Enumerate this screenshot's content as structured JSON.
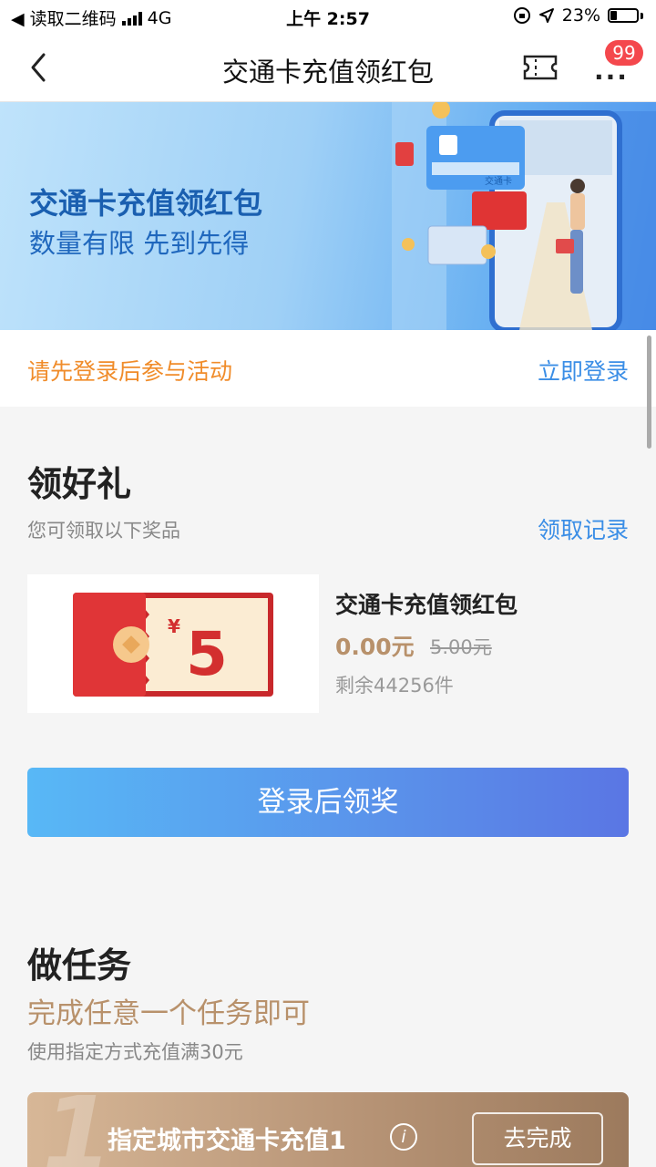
{
  "status_bar": {
    "back_app": "◀ 读取二维码",
    "network": "4G",
    "time": "上午 2:57",
    "battery": "23%"
  },
  "nav": {
    "title": "交通卡充值领红包",
    "more_label": "···",
    "badge": "99"
  },
  "banner": {
    "title": "交通卡充值领红包",
    "subtitle": "数量有限 先到先得",
    "card_label": "交通卡"
  },
  "login": {
    "hint": "请先登录后参与活动",
    "link": "立即登录"
  },
  "gifts": {
    "title": "领好礼",
    "desc": "您可领取以下奖品",
    "record_link": "领取记录",
    "item": {
      "yen": "¥",
      "amount": "5",
      "name": "交通卡充值领红包",
      "price": "0.00元",
      "original_price": "5.00元",
      "remaining": "剩余44256件"
    },
    "button": "登录后领奖"
  },
  "tasks": {
    "title": "做任务",
    "hint": "完成任意一个任务即可",
    "desc": "使用指定方式充值满30元",
    "items": [
      {
        "number": "1",
        "name": "指定城市交通卡充值1",
        "info": "i",
        "action": "去完成"
      }
    ]
  },
  "colors": {
    "accent_blue": "#3b8ee6",
    "warning_orange": "#f08c2a",
    "gold": "#b8916b",
    "badge_red": "#f4484d"
  }
}
